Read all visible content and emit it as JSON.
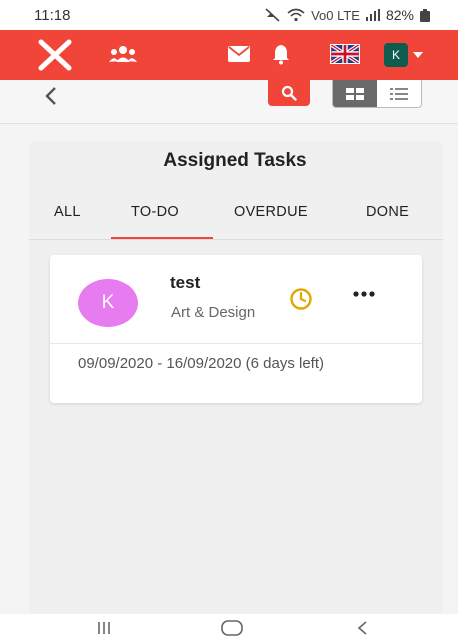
{
  "status_bar": {
    "time": "11:18",
    "network_label": "Vo0 LTE",
    "battery": "82%"
  },
  "header": {
    "icons": [
      "logo-x-icon",
      "team-icon",
      "mail-icon",
      "bell-icon",
      "uk-flag-icon",
      "user-avatar",
      "caret-down-icon"
    ],
    "user_initial": "K",
    "brand_color": "#f1453a"
  },
  "toolbar": {
    "icons": [
      "back-chevron-icon",
      "search-icon",
      "grid-view-icon",
      "list-view-icon"
    ]
  },
  "panel": {
    "title": "Assigned Tasks",
    "tabs": [
      {
        "label": "ALL"
      },
      {
        "label": "TO-DO"
      },
      {
        "label": "OVERDUE"
      },
      {
        "label": "DONE"
      }
    ],
    "active_tab": "TO-DO"
  },
  "task": {
    "avatar_letter": "K",
    "avatar_color": "#e77bf0",
    "title": "test",
    "category": "Art & Design",
    "dates": "09/09/2020 - 16/09/2020 (6 days left)",
    "status_icon": "clock-icon",
    "status_color": "#e0a800"
  },
  "nav_bar": {
    "icons": [
      "recent-apps-icon",
      "home-icon",
      "back-icon"
    ]
  }
}
